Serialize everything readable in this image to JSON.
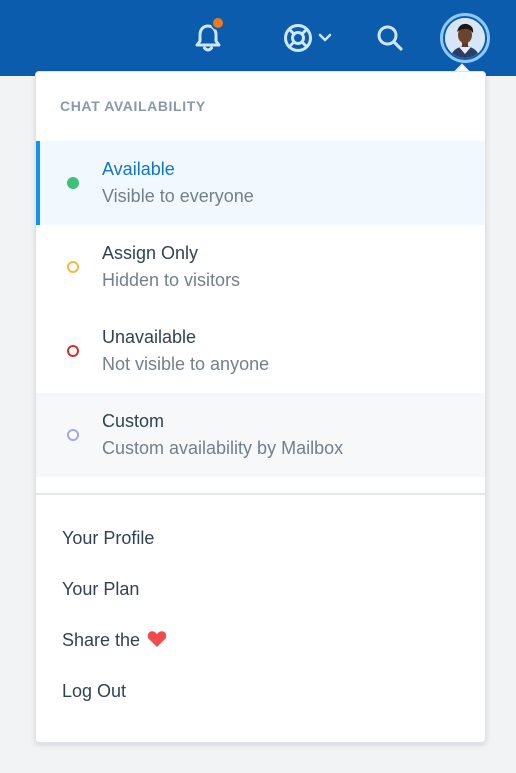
{
  "topbar": {
    "icons": [
      "bell-icon",
      "help-icon",
      "chevron-down-icon",
      "search-icon",
      "avatar"
    ],
    "notification_color": "#f0771c",
    "background": "#0b5cad"
  },
  "menu": {
    "heading": "CHAT AVAILABILITY",
    "statuses": [
      {
        "title": "Available",
        "subtitle": "Visible to everyone",
        "color": "#3ec07a",
        "selected": true
      },
      {
        "title": "Assign Only",
        "subtitle": "Hidden to visitors",
        "color": "#f5b93f",
        "selected": false
      },
      {
        "title": "Unavailable",
        "subtitle": "Not visible to anyone",
        "color": "#d6302e",
        "selected": false
      },
      {
        "title": "Custom",
        "subtitle": "Custom availability by Mailbox",
        "color": "#a3a6f0",
        "selected": false
      }
    ],
    "links": {
      "profile": "Your Profile",
      "plan": "Your Plan",
      "share": "Share the",
      "logout": "Log Out"
    }
  }
}
